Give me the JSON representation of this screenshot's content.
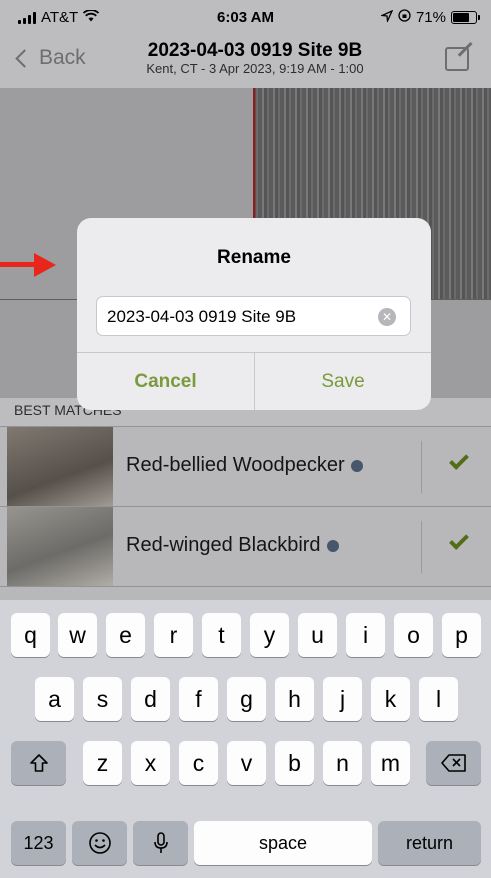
{
  "status_bar": {
    "carrier": "AT&T",
    "time": "6:03 AM",
    "battery": "71%",
    "battery_level": 0.71
  },
  "nav": {
    "back_label": "Back",
    "title": "2023-04-03 0919 Site 9B",
    "subtitle": "Kent, CT - 3 Apr 2023, 9:19 AM - 1:00"
  },
  "section_label": "BEST MATCHES",
  "matches": [
    {
      "name": "Red-bellied Woodpecker"
    },
    {
      "name": "Red-winged Blackbird"
    }
  ],
  "dialog": {
    "title": "Rename",
    "input_value": "2023-04-03 0919 Site 9B",
    "cancel_label": "Cancel",
    "save_label": "Save"
  },
  "keyboard": {
    "row1": [
      "q",
      "w",
      "e",
      "r",
      "t",
      "y",
      "u",
      "i",
      "o",
      "p"
    ],
    "row2": [
      "a",
      "s",
      "d",
      "f",
      "g",
      "h",
      "j",
      "k",
      "l"
    ],
    "row3": [
      "z",
      "x",
      "c",
      "v",
      "b",
      "n",
      "m"
    ],
    "numbers_label": "123",
    "space_label": "space",
    "return_label": "return"
  },
  "colors": {
    "accent_green": "#7a9a3c",
    "annotation_arrow": "#e8261c"
  }
}
